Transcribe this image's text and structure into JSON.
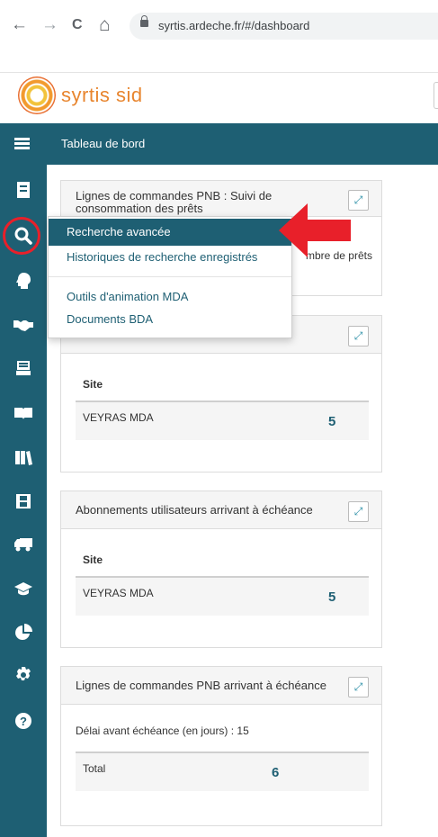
{
  "browser": {
    "back": "←",
    "forward": "→",
    "reload": "C",
    "home": "⌂",
    "url": "syrtis.ardeche.fr/#/dashboard"
  },
  "app": {
    "logo": "syrtis sid",
    "page_title": "Tableau de bord"
  },
  "sidebar_icons": [
    "book-return-icon",
    "search-icon",
    "user-head-icon",
    "handshake-icon",
    "archive-icon",
    "open-book-icon",
    "books-icon",
    "film-icon",
    "truck-icon",
    "graduation-cap-icon",
    "pie-chart-icon",
    "gear-icon",
    "help-icon"
  ],
  "dropdown": {
    "items": [
      {
        "label": "Recherche avancée",
        "active": true
      },
      {
        "label": "Historiques de recherche enregistrés",
        "active": false
      },
      {
        "label": "Outils d'animation MDA",
        "active": false
      },
      {
        "label": "Documents BDA",
        "active": false
      }
    ]
  },
  "panels": {
    "p1": {
      "title_line1": "Lignes de commandes PNB : Suivi de",
      "title_line2": "consommation des prêts",
      "peek_text": "mbre de prêts"
    },
    "p2": {
      "title": "",
      "header": "Site",
      "rows": [
        {
          "site": "VEYRAS MDA",
          "count": "5"
        }
      ]
    },
    "p3": {
      "title": "Abonnements utilisateurs arrivant à échéance",
      "header": "Site",
      "rows": [
        {
          "site": "VEYRAS MDA",
          "count": "5"
        }
      ]
    },
    "p4": {
      "title": "Lignes de commandes PNB arrivant à échéance",
      "delay": "Délai avant échéance (en jours) : 15",
      "total_label": "Total",
      "total_value": "6"
    }
  },
  "colors": {
    "primary": "#1e5f73",
    "annotation_red": "#e8202a",
    "logo_orange": "#e8852e"
  }
}
